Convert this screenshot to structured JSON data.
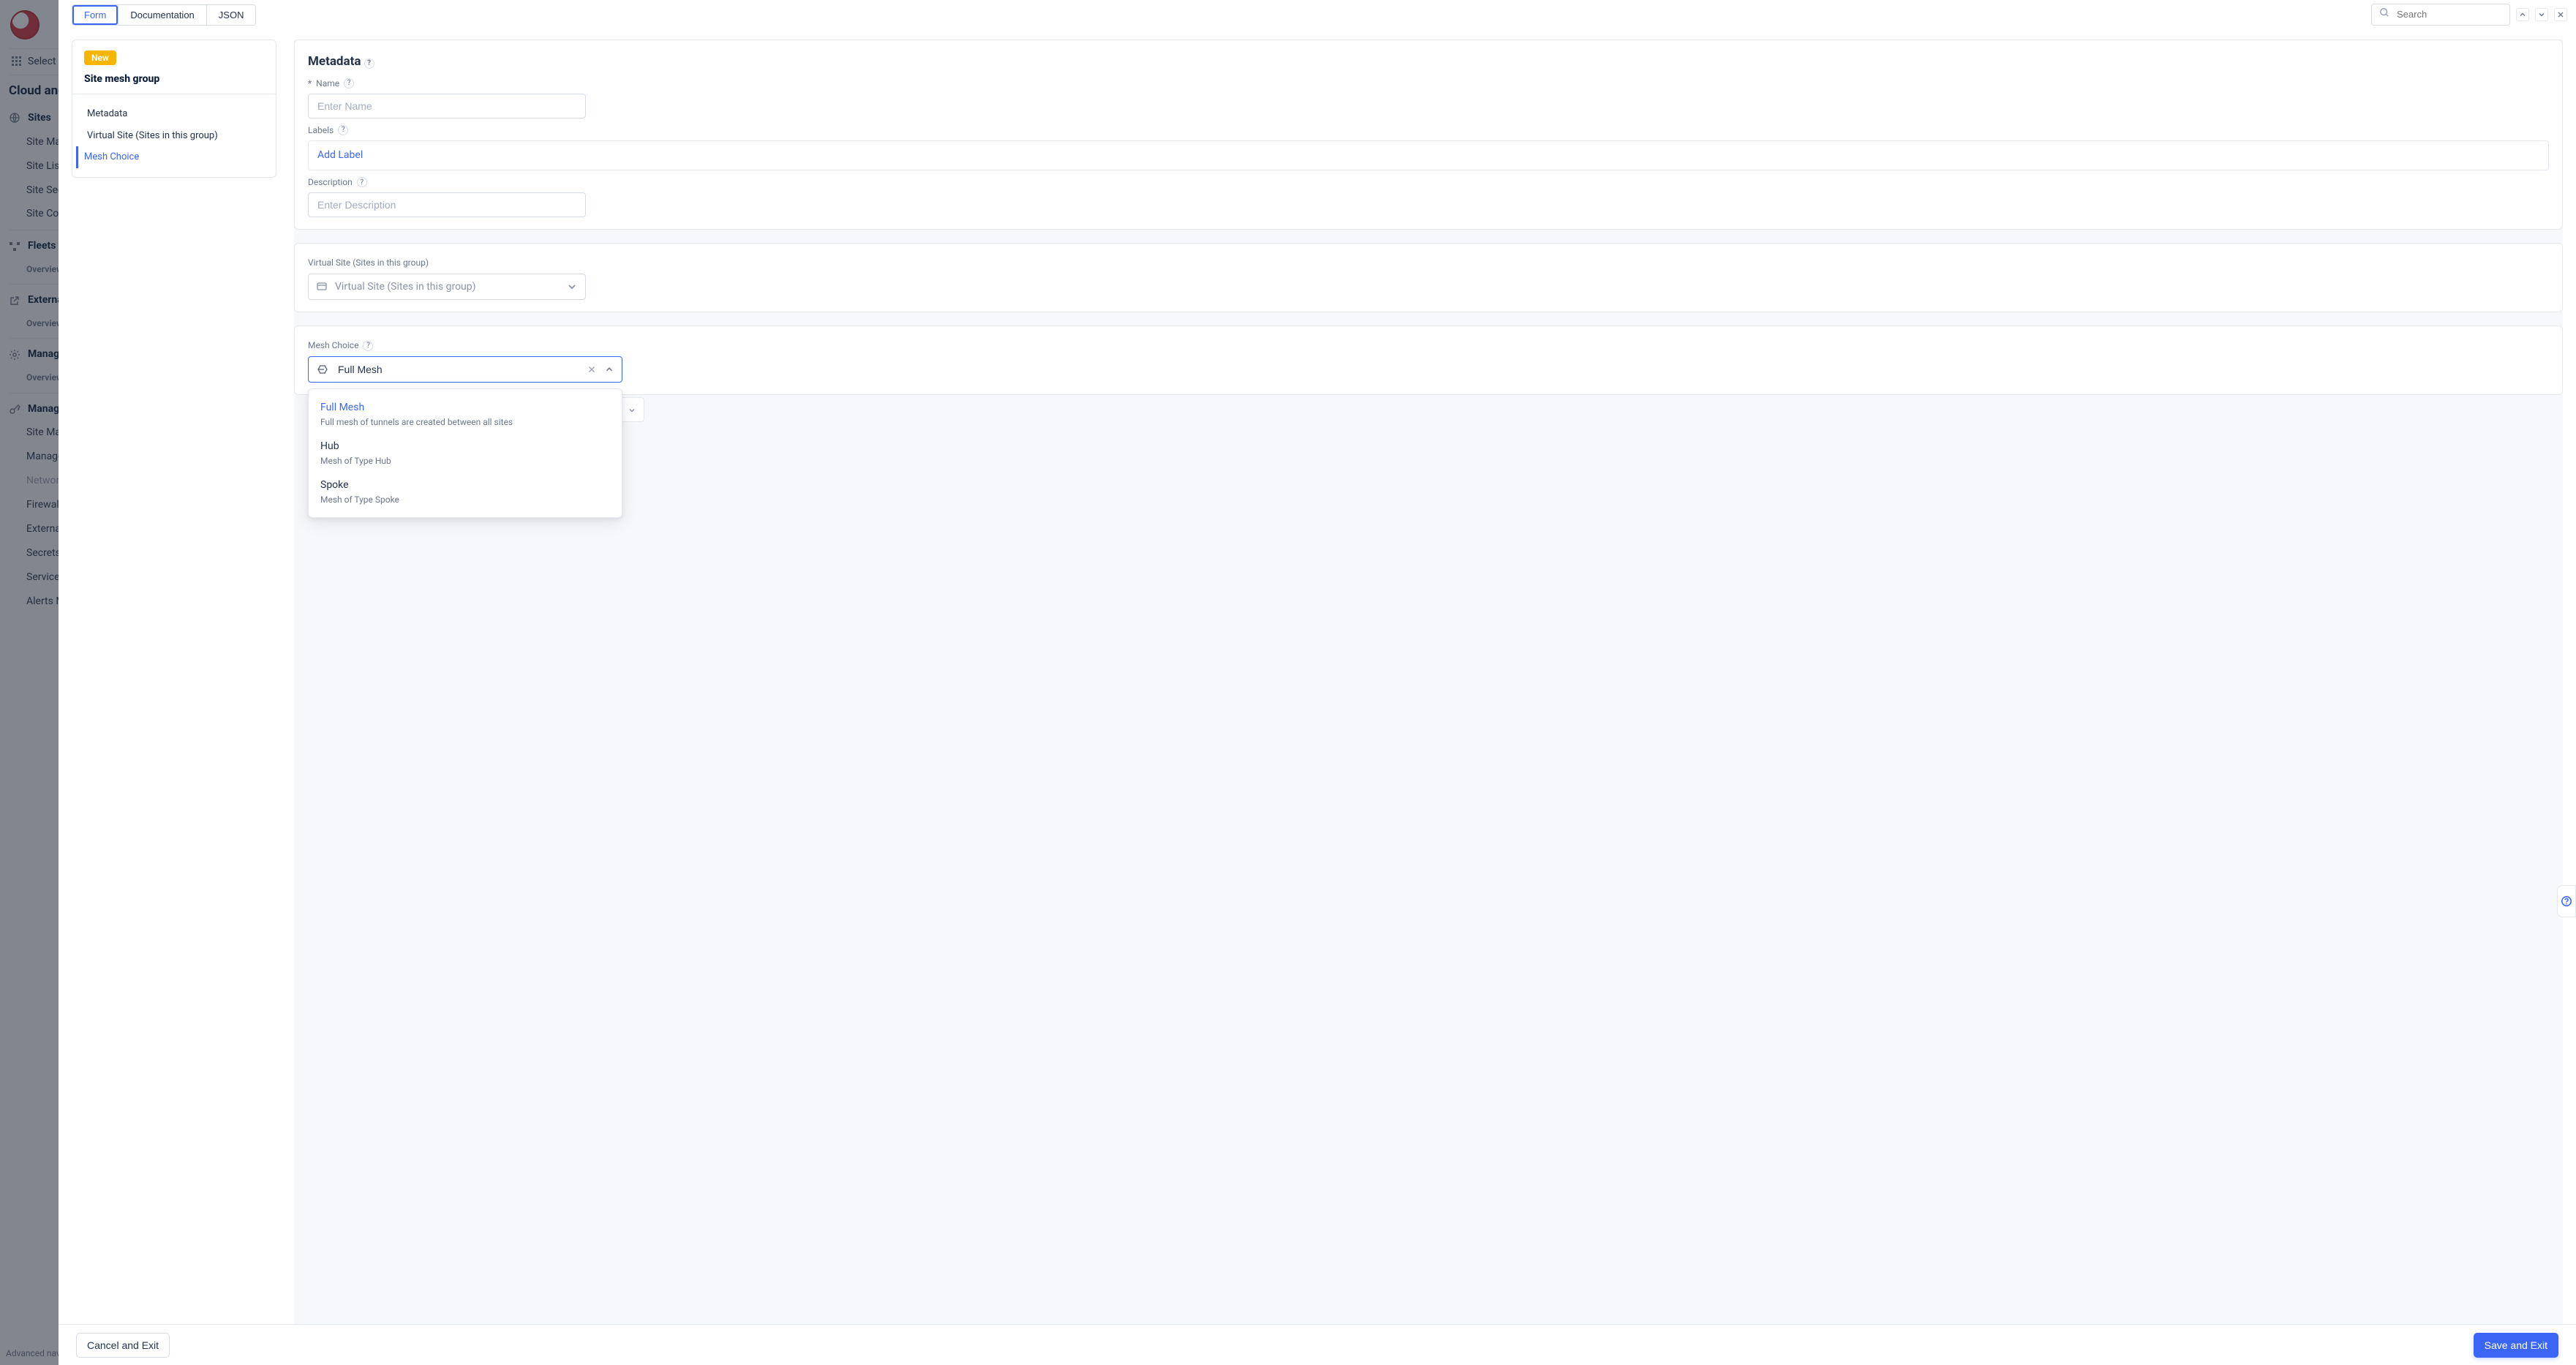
{
  "shell": {
    "select_services": "Select se",
    "app_title": "Cloud and",
    "nav": {
      "sites": "Sites",
      "site_map": "Site Map",
      "site_list": "Site List",
      "site_security": "Site Secu",
      "site_conn": "Site Conn",
      "fleets": "Fleets",
      "fleets_sub": "Overview",
      "external": "Externa",
      "external_sub": "Overview",
      "manage1": "Manage",
      "manage1_sub": "Overview",
      "manage2": "Manage",
      "site_mana": "Site Mana",
      "manage_h": "Manage H",
      "networking": "Networki",
      "firewall": "Firewall",
      "external_item": "External",
      "secrets": "Secrets",
      "service_d": "Service D",
      "alerts": "Alerts Ma",
      "adv_nav": "Advanced nav"
    }
  },
  "tabs": {
    "form": "Form",
    "docs": "Documentation",
    "json": "JSON"
  },
  "search": {
    "placeholder": "Search"
  },
  "outline": {
    "new_tag": "New",
    "title": "Site mesh group",
    "items": [
      "Metadata",
      "Virtual Site (Sites in this group)",
      "Mesh Choice"
    ],
    "active_index": 2
  },
  "form": {
    "metadata_title": "Metadata",
    "name_label": "Name",
    "name_required_prefix": "* ",
    "name_placeholder": "Enter Name",
    "labels_label": "Labels",
    "labels_add": "Add Label",
    "desc_label": "Description",
    "desc_placeholder": "Enter Description",
    "virtual_label": "Virtual Site (Sites in this group)",
    "virtual_placeholder": "Virtual Site (Sites in this group)",
    "mesh_label": "Mesh Choice",
    "mesh_value": "Full Mesh",
    "mesh_options": [
      {
        "title": "Full Mesh",
        "desc": "Full mesh of tunnels are created between all sites"
      },
      {
        "title": "Hub",
        "desc": "Mesh of Type Hub"
      },
      {
        "title": "Spoke",
        "desc": "Mesh of Type Spoke"
      }
    ]
  },
  "footer": {
    "cancel": "Cancel and Exit",
    "save": "Save and Exit"
  }
}
